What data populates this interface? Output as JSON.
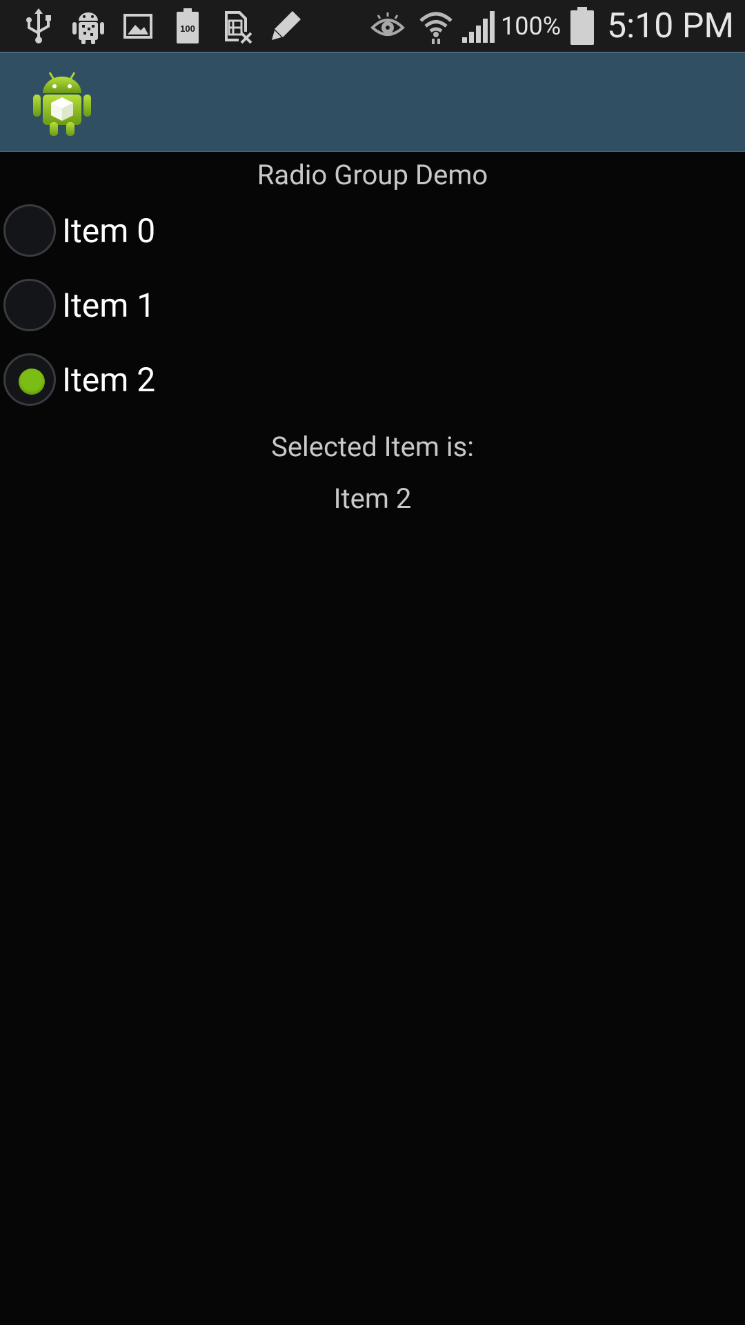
{
  "status_bar": {
    "battery_percent": "100%",
    "time": "5:10 PM",
    "icons": [
      "usb-icon",
      "android-debug-icon",
      "image-icon",
      "battery-saver-100-icon",
      "sim-blocked-icon",
      "pencil-icon",
      "eye-icon",
      "wifi-icon",
      "signal-icon",
      "battery-icon"
    ]
  },
  "action_bar": {
    "icon": "android-app-icon"
  },
  "main": {
    "title": "Radio Group Demo",
    "radio_items": [
      {
        "label": "Item 0",
        "checked": false
      },
      {
        "label": "Item 1",
        "checked": false
      },
      {
        "label": "Item 2",
        "checked": true
      }
    ],
    "selected_caption": "Selected Item is:",
    "selected_value": "Item 2"
  },
  "colors": {
    "status_bar_bg": "#1b1b1b",
    "action_bar_bg": "#314f63",
    "background": "#060606",
    "radio_accent": "#7bbd14"
  }
}
